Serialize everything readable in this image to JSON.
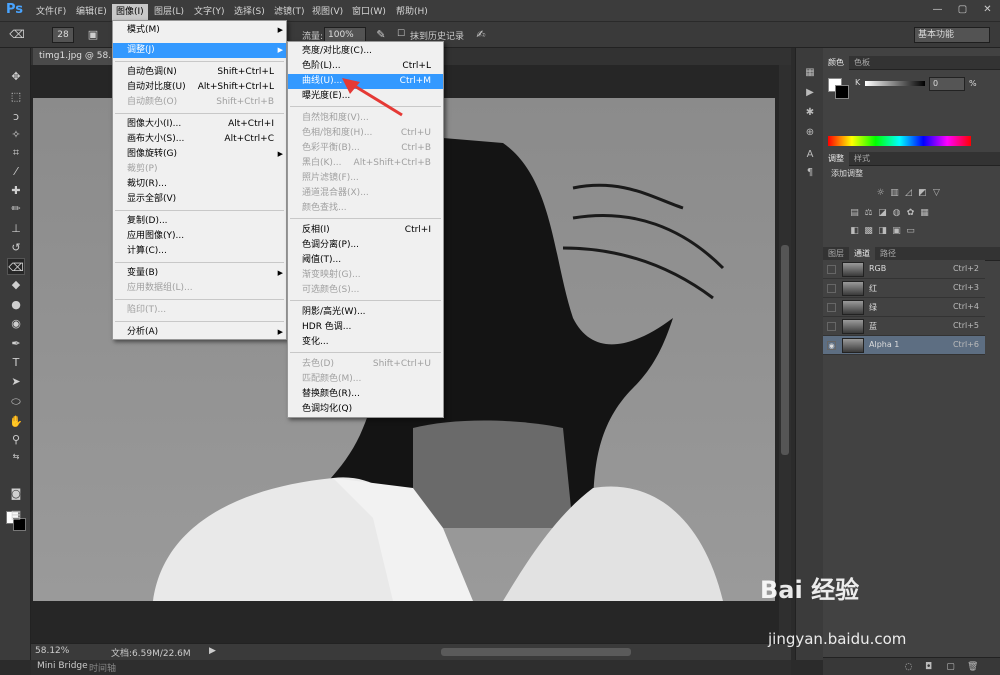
{
  "app": {
    "logo": "Ps"
  },
  "menubar": {
    "items": [
      "文件(F)",
      "编辑(E)",
      "图像(I)",
      "图层(L)",
      "文字(Y)",
      "选择(S)",
      "滤镜(T)",
      "视图(V)",
      "窗口(W)",
      "帮助(H)"
    ],
    "active_index": 2
  },
  "window_controls": {
    "minimize": "—",
    "maximize": "▢",
    "close": "✕"
  },
  "options": {
    "brush_size": "28",
    "flow_label": "流量:",
    "flow_value": "100%",
    "history_label": "抹到历史记录",
    "workspace": "基本功能"
  },
  "document": {
    "tab_title": "timg1.jpg @ 58.1%"
  },
  "status": {
    "zoom": "58.12%",
    "doc_size": "文档:6.59M/22.6M"
  },
  "bottom_tabs": [
    "Mini Bridge",
    "时间轴"
  ],
  "image_menu": [
    {
      "label": "模式(M)",
      "shortcut": "",
      "submenu": true,
      "disabled": false
    },
    {
      "label": "调整(J)",
      "shortcut": "",
      "submenu": true,
      "disabled": false,
      "highlighted": true
    },
    {
      "label": "自动色调(N)",
      "shortcut": "Shift+Ctrl+L",
      "disabled": false
    },
    {
      "label": "自动对比度(U)",
      "shortcut": "Alt+Shift+Ctrl+L",
      "disabled": false
    },
    {
      "label": "自动颜色(O)",
      "shortcut": "Shift+Ctrl+B",
      "disabled": true
    },
    {
      "label": "图像大小(I)...",
      "shortcut": "Alt+Ctrl+I",
      "disabled": false
    },
    {
      "label": "画布大小(S)...",
      "shortcut": "Alt+Ctrl+C",
      "disabled": false
    },
    {
      "label": "图像旋转(G)",
      "shortcut": "",
      "submenu": true,
      "disabled": false
    },
    {
      "label": "裁剪(P)",
      "shortcut": "",
      "disabled": true
    },
    {
      "label": "裁切(R)...",
      "shortcut": "",
      "disabled": false
    },
    {
      "label": "显示全部(V)",
      "shortcut": "",
      "disabled": false
    },
    {
      "label": "复制(D)...",
      "shortcut": "",
      "disabled": false
    },
    {
      "label": "应用图像(Y)...",
      "shortcut": "",
      "disabled": false
    },
    {
      "label": "计算(C)...",
      "shortcut": "",
      "disabled": false
    },
    {
      "label": "变量(B)",
      "shortcut": "",
      "submenu": true,
      "disabled": false
    },
    {
      "label": "应用数据组(L)...",
      "shortcut": "",
      "disabled": true
    },
    {
      "label": "陷印(T)...",
      "shortcut": "",
      "disabled": true
    },
    {
      "label": "分析(A)",
      "shortcut": "",
      "submenu": true,
      "disabled": false
    }
  ],
  "adjust_menu": [
    {
      "label": "亮度/对比度(C)...",
      "shortcut": "",
      "disabled": false
    },
    {
      "label": "色阶(L)...",
      "shortcut": "Ctrl+L",
      "disabled": false
    },
    {
      "label": "曲线(U)...",
      "shortcut": "Ctrl+M",
      "disabled": false,
      "highlighted": true
    },
    {
      "label": "曝光度(E)...",
      "shortcut": "",
      "disabled": false
    },
    {
      "label": "自然饱和度(V)...",
      "shortcut": "",
      "disabled": true
    },
    {
      "label": "色相/饱和度(H)...",
      "shortcut": "Ctrl+U",
      "disabled": true
    },
    {
      "label": "色彩平衡(B)...",
      "shortcut": "Ctrl+B",
      "disabled": true
    },
    {
      "label": "黑白(K)...",
      "shortcut": "Alt+Shift+Ctrl+B",
      "disabled": true
    },
    {
      "label": "照片滤镜(F)...",
      "shortcut": "",
      "disabled": true
    },
    {
      "label": "通道混合器(X)...",
      "shortcut": "",
      "disabled": true
    },
    {
      "label": "颜色查找...",
      "shortcut": "",
      "disabled": true
    },
    {
      "label": "反相(I)",
      "shortcut": "Ctrl+I",
      "disabled": false
    },
    {
      "label": "色调分离(P)...",
      "shortcut": "",
      "disabled": false
    },
    {
      "label": "阈值(T)...",
      "shortcut": "",
      "disabled": false
    },
    {
      "label": "渐变映射(G)...",
      "shortcut": "",
      "disabled": true
    },
    {
      "label": "可选颜色(S)...",
      "shortcut": "",
      "disabled": true
    },
    {
      "label": "阴影/高光(W)...",
      "shortcut": "",
      "disabled": false
    },
    {
      "label": "HDR 色调...",
      "shortcut": "",
      "disabled": false
    },
    {
      "label": "变化...",
      "shortcut": "",
      "disabled": false
    },
    {
      "label": "去色(D)",
      "shortcut": "Shift+Ctrl+U",
      "disabled": true
    },
    {
      "label": "匹配颜色(M)...",
      "shortcut": "",
      "disabled": true
    },
    {
      "label": "替换颜色(R)...",
      "shortcut": "",
      "disabled": false
    },
    {
      "label": "色调均化(Q)",
      "shortcut": "",
      "disabled": false
    }
  ],
  "color_panel": {
    "tabs": [
      "颜色",
      "色板"
    ],
    "channel_label": "K",
    "value": "0",
    "unit": "%"
  },
  "adjust_panel": {
    "tabs": [
      "调整",
      "样式"
    ],
    "title": "添加调整"
  },
  "channels_panel": {
    "tabs": [
      "图层",
      "通道",
      "路径"
    ],
    "active_tab": 1,
    "channels": [
      {
        "name": "RGB",
        "shortcut": "Ctrl+2",
        "visible": false,
        "selected": false
      },
      {
        "name": "红",
        "shortcut": "Ctrl+3",
        "visible": false,
        "selected": false
      },
      {
        "name": "绿",
        "shortcut": "Ctrl+4",
        "visible": false,
        "selected": false
      },
      {
        "name": "蓝",
        "shortcut": "Ctrl+5",
        "visible": false,
        "selected": false
      },
      {
        "name": "Alpha 1",
        "shortcut": "Ctrl+6",
        "visible": true,
        "selected": true
      }
    ]
  },
  "watermark": {
    "brand": "Bai 经验",
    "url": "jingyan.baidu.com"
  },
  "colors": {
    "accent": "#3399ff",
    "arrow": "#e53935",
    "selected_channel": "#5d6e82"
  }
}
